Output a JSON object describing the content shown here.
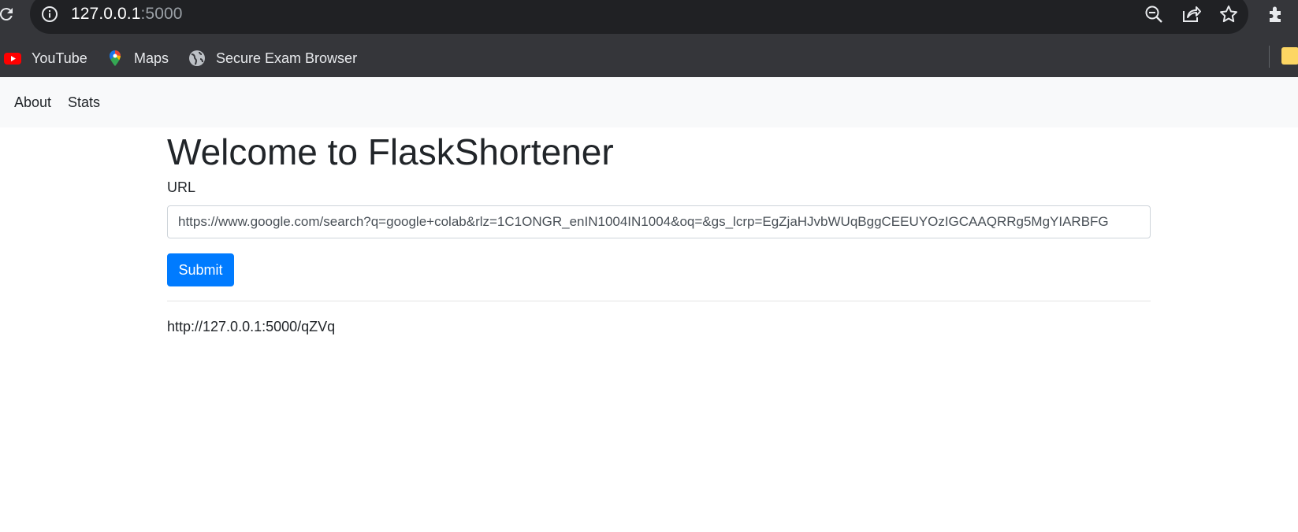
{
  "browser": {
    "address_host": "127.0.0.1",
    "address_port": ":5000",
    "bookmarks": [
      {
        "label": "YouTube",
        "icon": "youtube-icon"
      },
      {
        "label": "Maps",
        "icon": "maps-icon"
      },
      {
        "label": "Secure Exam Browser",
        "icon": "globe-icon"
      }
    ],
    "icons": [
      "reload-icon",
      "info-icon",
      "zoom-out-icon",
      "share-icon",
      "star-icon",
      "extensions-icon",
      "bookmark-folder-icon"
    ]
  },
  "navbar": {
    "links": [
      {
        "label": "About"
      },
      {
        "label": "Stats"
      }
    ]
  },
  "main": {
    "title": "Welcome to FlaskShortener",
    "url_label": "URL",
    "url_value": "https://www.google.com/search?q=google+colab&rlz=1C1ONGR_enIN1004IN1004&oq=&gs_lcrp=EgZjaHJvbWUqBggCEEUYOzIGCAAQRRg5MgYIARBFG",
    "submit_label": "Submit",
    "short_url": "http://127.0.0.1:5000/qZVq"
  },
  "colors": {
    "primary": "#007bff",
    "navbar_bg": "#f8f9fa",
    "chrome_bg": "#35363a",
    "omnibox_bg": "#202124"
  }
}
